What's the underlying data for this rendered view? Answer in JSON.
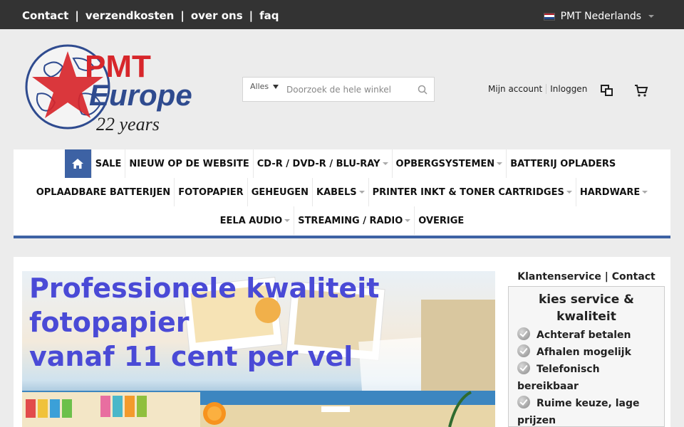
{
  "topbar": {
    "links": [
      "Contact",
      "verzendkosten",
      "over ons",
      "faq"
    ],
    "separator": "|",
    "language": "PMT Nederlands"
  },
  "logo": {
    "line1": "PMT",
    "line2": "Europe",
    "line3": "22 years"
  },
  "search": {
    "category": "Alles",
    "placeholder": "Doorzoek de hele winkel"
  },
  "account": {
    "my_account": "Mijn account",
    "login": "Inloggen"
  },
  "nav": {
    "row1": [
      {
        "label": "SALE",
        "dropdown": false
      },
      {
        "label": "NIEUW OP DE WEBSITE",
        "dropdown": false
      },
      {
        "label": "CD-R / DVD-R / BLU-RAY",
        "dropdown": true
      },
      {
        "label": "OPBERGSYSTEMEN",
        "dropdown": true
      },
      {
        "label": "BATTERIJ OPLADERS",
        "dropdown": false
      }
    ],
    "row2": [
      {
        "label": "OPLAADBARE BATTERIJEN",
        "dropdown": false
      },
      {
        "label": "FOTOPAPIER",
        "dropdown": false
      },
      {
        "label": "GEHEUGEN",
        "dropdown": false
      },
      {
        "label": "KABELS",
        "dropdown": true
      },
      {
        "label": "PRINTER INKT & TONER CARTRIDGES",
        "dropdown": true
      },
      {
        "label": "HARDWARE",
        "dropdown": true
      }
    ],
    "row3": [
      {
        "label": "EELA AUDIO",
        "dropdown": true
      },
      {
        "label": "STREAMING / RADIO",
        "dropdown": true
      },
      {
        "label": "OVERIGE",
        "dropdown": false
      }
    ]
  },
  "banner": {
    "line1": "Professionele kwaliteit",
    "line2": "fotopapier",
    "line3": "vanaf 11 cent per vel"
  },
  "sidebar": {
    "title": "Klantenservice | Contact",
    "heading": "kies service & kwaliteit",
    "items": [
      "Achteraf betalen",
      "Afhalen mogelijk",
      "Telefonisch bereikbaar",
      "Ruime keuze, lage prijzen"
    ]
  },
  "colors": {
    "topbar": "#333333",
    "nav_accent": "#3d62a4",
    "logo_red": "#d7262b",
    "logo_blue": "#2f4b8f",
    "banner_text": "#4a4ad6"
  },
  "icons": [
    "home-icon",
    "search-icon",
    "compare-icon",
    "cart-icon",
    "checkmark-icon",
    "flag-nl-icon"
  ]
}
